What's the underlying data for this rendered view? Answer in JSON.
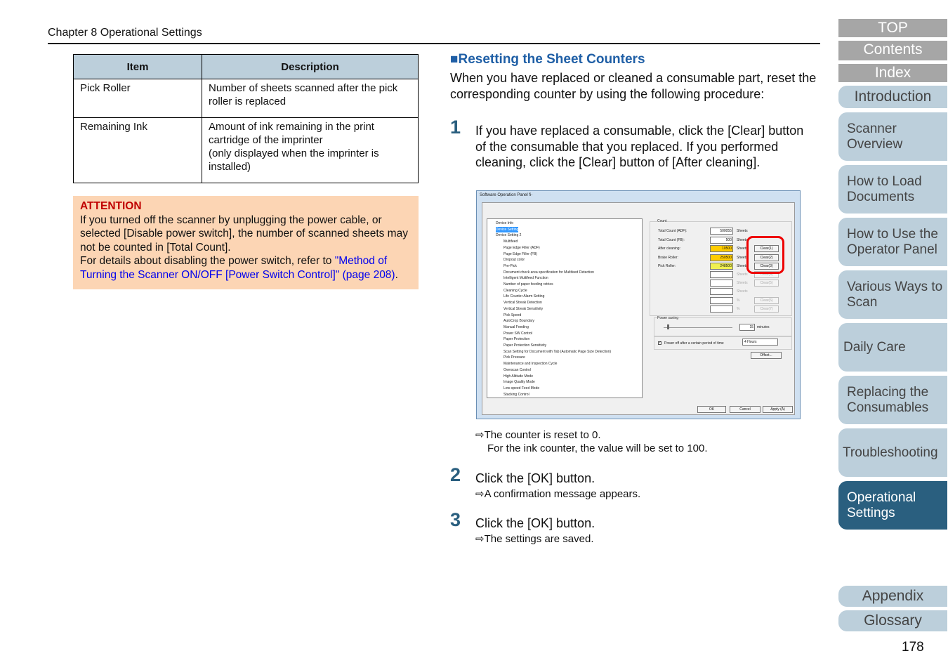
{
  "header": {
    "chapter": "Chapter 8 Operational Settings"
  },
  "table": {
    "headers": [
      "Item",
      "Description"
    ],
    "rows": [
      {
        "item": "Pick Roller",
        "desc": "Number of sheets scanned after the pick roller is replaced"
      },
      {
        "item": "Remaining Ink",
        "desc": "Amount of ink remaining in the print cartridge of the imprinter",
        "note": "(only displayed when the imprinter is installed)"
      }
    ]
  },
  "attention": {
    "title": "ATTENTION",
    "text": "If you turned off the scanner by unplugging the power cable, or selected [Disable power switch], the number of scanned sheets may not be counted in [Total Count].",
    "text2": "For details about disabling the power switch, refer to ",
    "link": "\"Method of Turning the Scanner ON/OFF [Power Switch Control]\" (page 208)",
    "end": "."
  },
  "section": {
    "title": "■Resetting the Sheet Counters",
    "intro": "When you have replaced or cleaned a consumable part, reset the corresponding counter by using the following procedure:"
  },
  "steps": [
    {
      "num": "1",
      "text": "If you have replaced a consumable, click the [Clear] button of the consumable that you replaced. If you performed cleaning, click the [Clear] button of [After cleaning].",
      "result": "⇨The counter is reset to 0.",
      "result2": "For the ink counter, the value will be set to 100."
    },
    {
      "num": "2",
      "text": "Click the [OK] button.",
      "result": "⇨A confirmation message appears."
    },
    {
      "num": "3",
      "text": "Click the [OK] button.",
      "result": "⇨The settings are saved."
    }
  ],
  "dialog": {
    "title": "Software Operation Panel fi-",
    "tree": [
      "Device Info",
      "Device Setting",
      "Device Setting 2",
      "Multifeed",
      "Page Edge Filler (ADF)",
      "Page Edge Filler (FB)",
      "Dropout color",
      "Pre-Pick",
      "Document check area specification for Multifeed Detection",
      "Intelligent Multifeed Function",
      "Number of paper feeding retries",
      "Cleaning Cycle",
      "Life Counter Alarm Setting",
      "Vertical Streak Detection",
      "Vertical Streak Sensitivity",
      "Pick Speed",
      "AutoCrop Boundary",
      "Manual Feeding",
      "Power SW Control",
      "Paper Protection",
      "Paper Protection Sensitivity",
      "Scan Setting for Document with Tab (Automatic Page Size Detection)",
      "Pick Pressure",
      "Maintenance and Inspection Cycle",
      "Overscan Control",
      "High Altitude Mode",
      "Image Quality Mode",
      "Low-speed Feed Mode",
      "Stacking Control"
    ],
    "count_label": "Count",
    "counters": [
      {
        "label": "Total Count (ADF):",
        "value": "500055",
        "unit": "Sheets"
      },
      {
        "label": "Total Count (FB):",
        "value": "500",
        "unit": "Sheets"
      },
      {
        "label": "After cleaning:",
        "value": "10500",
        "unit": "Sheets",
        "button": "Clear(1)"
      },
      {
        "label": "Brake Roller:",
        "value": "250500",
        "unit": "Sheets",
        "button": "Clear(2)"
      },
      {
        "label": "Pick Roller:",
        "value": "248500",
        "unit": "Sheets",
        "button": "Clear(3)"
      },
      {
        "unit": "Sheets",
        "button": "Clear(4)"
      },
      {
        "unit": "Sheets",
        "button": "Clear(5)"
      },
      {
        "unit": "Sheets"
      },
      {
        "unit": "%",
        "button": "Clear(6)"
      },
      {
        "unit": "%",
        "button": "Clear(7)"
      }
    ],
    "field_colors": {
      "orange": "#ffcc00",
      "yellow": "#f0f050"
    },
    "power_saving": {
      "label": "Power saving",
      "value": "15",
      "unit": "minutes",
      "power_off_label": "Power off after a certain period of time",
      "power_off_checked": true,
      "power_off_value": "4 Hours"
    },
    "offset": "Offset...",
    "ok": "OK",
    "cancel": "Cancel",
    "apply": "Apply (A)"
  },
  "sidebar": {
    "nav": [
      "TOP",
      "Contents",
      "Index"
    ],
    "tabs": [
      "Introduction",
      "Scanner Overview",
      "How to Load Documents",
      "How to Use the Operator Panel",
      "Various Ways to Scan",
      "Daily Care",
      "Replacing the Consumables",
      "Troubleshooting",
      "Operational Settings",
      "Appendix",
      "Glossary"
    ],
    "active": "Operational Settings"
  },
  "page_number": "178"
}
